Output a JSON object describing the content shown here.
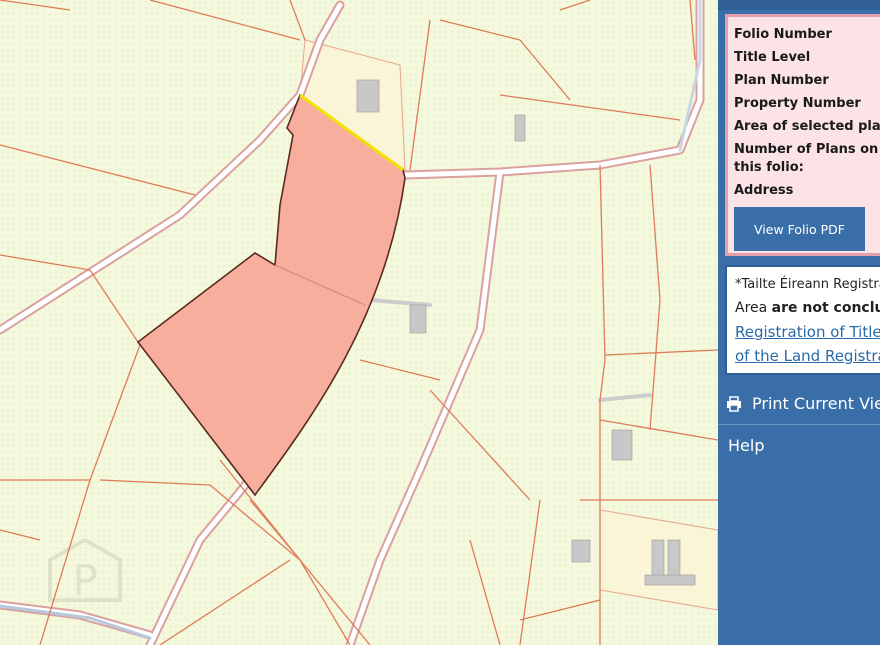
{
  "map": {
    "watermark_letter": "P",
    "colors": {
      "background": "#f4f8dc",
      "boundary": "#e07a5a",
      "road_fill": "#ffffff",
      "road_edge": "#dba0a0",
      "highlight_fill": "#f7ae9c",
      "highlight_stroke": "#5a2a22",
      "selected_edge": "#f2e200",
      "building": "#c8c8c8"
    }
  },
  "panel": {
    "folio_labels": [
      "Folio Number",
      "Title Level",
      "Plan Number",
      "Property Number",
      "Area of selected plans",
      "Number of Plans on",
      "this folio:",
      "Address"
    ],
    "view_pdf_label": "View Folio PDF",
    "disclaimer": {
      "line1": "*Tailte Éireann Registrat",
      "line2_start": "Area ",
      "line2_bold": "are not conclusive",
      "link_line1": "Registration of Title A",
      "link_line2": "of the Land Registrati"
    },
    "print_label": "Print Current View",
    "print_icon": "printer-icon",
    "help_label": "Help"
  }
}
